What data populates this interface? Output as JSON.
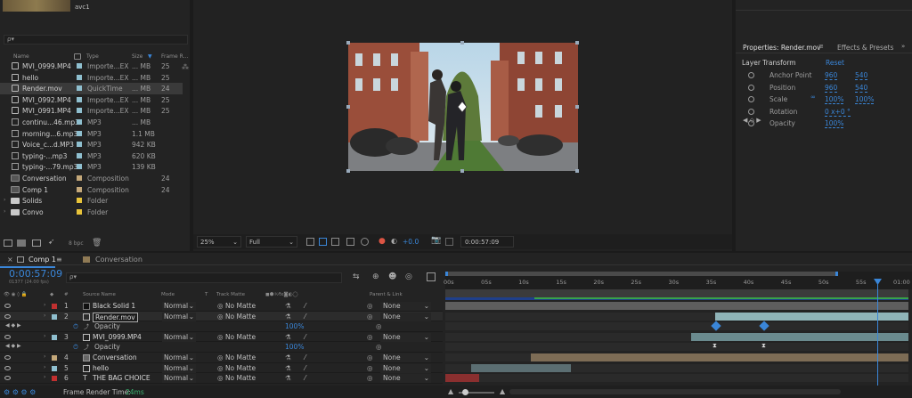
{
  "project": {
    "thumb_info": "avc1",
    "search_placeholder": "ρ▾",
    "columns": {
      "name": "Name",
      "type": "Type",
      "size": "Size",
      "frame_rate": "Frame R..."
    },
    "items": [
      {
        "name": "MVI_0999.MP4",
        "type": "Importe...EX",
        "size": "... MB",
        "fr": "25",
        "icon": "video",
        "swatch": "#8fbfcf",
        "selected": false
      },
      {
        "name": "hello",
        "type": "Importe...EX",
        "size": "... MB",
        "fr": "25",
        "icon": "video",
        "swatch": "#8fbfcf",
        "selected": false
      },
      {
        "name": "Render.mov",
        "type": "QuickTime",
        "size": "... MB",
        "fr": "24",
        "icon": "video",
        "swatch": "#8fbfcf",
        "selected": true
      },
      {
        "name": "MVI_0992.MP4",
        "type": "Importe...EX",
        "size": "... MB",
        "fr": "25",
        "icon": "video",
        "swatch": "#8fbfcf",
        "selected": false
      },
      {
        "name": "MVI_0991.MP4",
        "type": "Importe...EX",
        "size": "... MB",
        "fr": "25",
        "icon": "video",
        "swatch": "#8fbfcf",
        "selected": false
      },
      {
        "name": "continu...46.mp3",
        "type": "MP3",
        "size": "... MB",
        "fr": "",
        "icon": "audio",
        "swatch": "#8fbfcf",
        "selected": false
      },
      {
        "name": "morning...6.mp3",
        "type": "MP3",
        "size": "1.1 MB",
        "fr": "",
        "icon": "audio",
        "swatch": "#8fbfcf",
        "selected": false
      },
      {
        "name": "Voice_c...d.MP3",
        "type": "MP3",
        "size": "942 KB",
        "fr": "",
        "icon": "audio",
        "swatch": "#8fbfcf",
        "selected": false
      },
      {
        "name": "typing-...mp3",
        "type": "MP3",
        "size": "620 KB",
        "fr": "",
        "icon": "audio",
        "swatch": "#8fbfcf",
        "selected": false
      },
      {
        "name": "typing-...79.mp3",
        "type": "MP3",
        "size": "139 KB",
        "fr": "",
        "icon": "audio",
        "swatch": "#8fbfcf",
        "selected": false
      },
      {
        "name": "Conversation",
        "type": "Composition",
        "size": "",
        "fr": "24",
        "icon": "comp",
        "swatch": "#c4a87a",
        "selected": false
      },
      {
        "name": "Comp 1",
        "type": "Composition",
        "size": "",
        "fr": "24",
        "icon": "comp",
        "swatch": "#c4a87a",
        "selected": false
      },
      {
        "name": "Solids",
        "type": "Folder",
        "size": "",
        "fr": "",
        "icon": "folder",
        "swatch": "#e8c33a",
        "selected": false,
        "twirl": true
      },
      {
        "name": "Convo",
        "type": "Folder",
        "size": "",
        "fr": "",
        "icon": "folder",
        "swatch": "#e8c33a",
        "selected": false,
        "twirl": true
      }
    ],
    "bpc": "8 bpc"
  },
  "viewer": {
    "zoom": "25%",
    "resolution": "Full",
    "exposure": "+0.0",
    "timecode": "0:00:57:09"
  },
  "properties": {
    "tab_title": "Properties: Render.mov",
    "tab_effects": "Effects & Presets",
    "section": "Layer Transform",
    "reset": "Reset",
    "rows": [
      {
        "label": "Anchor Point",
        "v1": "960",
        "v2": "540"
      },
      {
        "label": "Position",
        "v1": "960",
        "v2": "540"
      },
      {
        "label": "Scale",
        "v1": "100%",
        "v2": "100%"
      },
      {
        "label": "Rotation",
        "v1": "0 x+0 °",
        "v2": ""
      },
      {
        "label": "Opacity",
        "v1": "100%",
        "v2": ""
      }
    ]
  },
  "timeline": {
    "tabs": [
      {
        "label": "Comp 1"
      },
      {
        "label": "Conversation"
      }
    ],
    "timecode": "0:00:57:09",
    "timecode_sub": "01377 (24.00 fps)",
    "columns": {
      "source_name": "Source Name",
      "mode": "Mode",
      "t": "T",
      "track_matte": "Track Matte",
      "parent_link": "Parent & Link"
    },
    "ruler_labels": [
      "00s",
      "05s",
      "10s",
      "15s",
      "20s",
      "25s",
      "30s",
      "35s",
      "40s",
      "45s",
      "50s",
      "55s",
      "01:00"
    ],
    "layers": [
      {
        "kind": "layer",
        "num": "1",
        "name": "Black Solid 1",
        "icon": "solid",
        "label_color": "#c03030",
        "mode": "Normal",
        "matte": "No Matte",
        "parent": "None"
      },
      {
        "kind": "layer",
        "num": "2",
        "name": "Render.mov",
        "icon": "video",
        "label_color": "#8fbfcf",
        "mode": "Normal",
        "matte": "No Matte",
        "parent": "None",
        "selected": true,
        "boxed": true
      },
      {
        "kind": "prop",
        "name": "Opacity",
        "value": "100%"
      },
      {
        "kind": "layer",
        "num": "3",
        "name": "MVI_0999.MP4",
        "icon": "video",
        "label_color": "#8fbfcf",
        "mode": "Normal",
        "matte": "No Matte",
        "parent": "None"
      },
      {
        "kind": "prop",
        "name": "Opacity",
        "value": "100%"
      },
      {
        "kind": "layer",
        "num": "4",
        "name": "Conversation",
        "icon": "comp",
        "label_color": "#c4a87a",
        "mode": "Normal",
        "matte": "No Matte",
        "parent": "None"
      },
      {
        "kind": "layer",
        "num": "5",
        "name": "hello",
        "icon": "video",
        "label_color": "#8fbfcf",
        "mode": "Normal",
        "matte": "No Matte",
        "parent": "None"
      },
      {
        "kind": "layer",
        "num": "6",
        "name": "THE BAG CHOICE",
        "icon": "text",
        "label_color": "#c03030",
        "mode": "Normal",
        "matte": "No Matte",
        "parent": "None"
      }
    ],
    "status_label": "Frame Render Time:",
    "status_value": "24ms"
  }
}
